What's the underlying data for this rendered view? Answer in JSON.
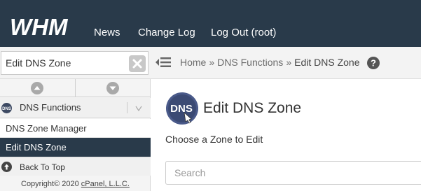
{
  "header": {
    "logo_text": "WHM",
    "nav": [
      {
        "label": "News"
      },
      {
        "label": "Change Log"
      },
      {
        "label": "Log Out (root)"
      }
    ]
  },
  "search": {
    "value": "Edit DNS Zone"
  },
  "breadcrumb": {
    "items": [
      "Home",
      "DNS Functions",
      "Edit DNS Zone"
    ],
    "separator": "»"
  },
  "sidebar": {
    "group": {
      "label": "DNS Functions",
      "icon_text": "DNS"
    },
    "items": [
      {
        "label": "DNS Zone Manager",
        "active": false
      },
      {
        "label": "Edit DNS Zone",
        "active": true
      }
    ],
    "back_to_top": "Back To Top",
    "copyright_prefix": "Copyright© 2020",
    "copyright_link": "cPanel, L.L.C."
  },
  "main": {
    "title": "Edit DNS Zone",
    "logo_text": "DNS",
    "subtitle": "Choose a Zone to Edit",
    "zone_search_placeholder": "Search"
  },
  "colors": {
    "header_bg": "#293a4a",
    "active_item_bg": "#293a4a",
    "logo_circle": "#4a5a8a"
  }
}
